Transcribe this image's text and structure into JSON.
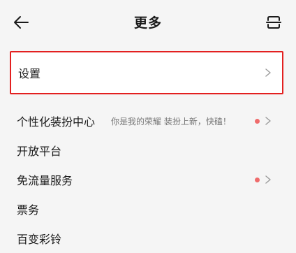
{
  "header": {
    "title": "更多"
  },
  "settings": {
    "label": "设置"
  },
  "list": {
    "items": [
      {
        "label": "个性化装扮中心",
        "subtitle": "你是我的荣耀 装扮上新，快磕！"
      },
      {
        "label": "开放平台"
      },
      {
        "label": "免流量服务"
      },
      {
        "label": "票务"
      },
      {
        "label": "百变彩铃"
      }
    ]
  },
  "colors": {
    "highlight_border": "#e32020",
    "badge_dot": "#ef6b6b",
    "background": "#f5f5f5"
  },
  "icons": {
    "back": "arrow-left-icon",
    "scan": "scan-icon",
    "chevron": "chevron-right-icon"
  }
}
